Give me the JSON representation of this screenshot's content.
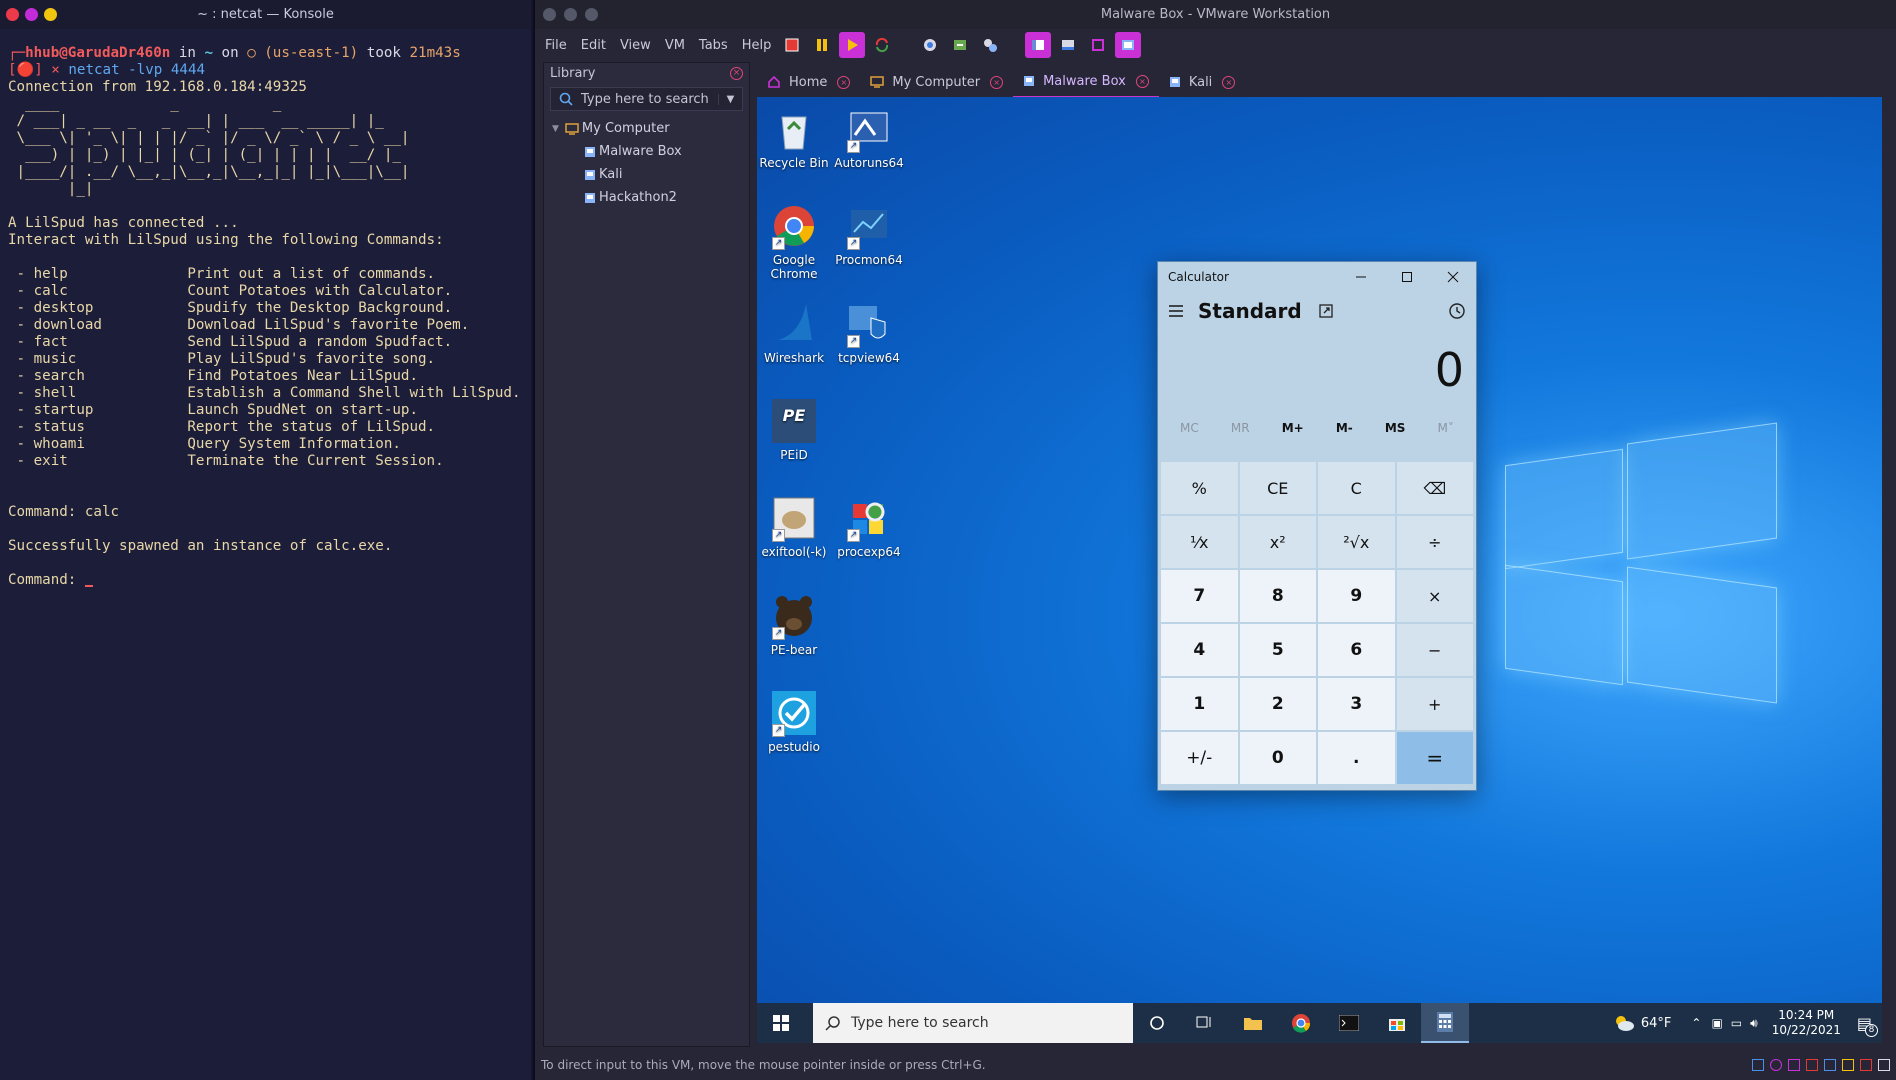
{
  "konsole": {
    "title": "~ : netcat — Konsole",
    "prompt_user": "┌─hhub@GarudaDr460n",
    "prompt_in": " in ",
    "prompt_dir": "~",
    "prompt_on": " on ",
    "prompt_aws": "○ (us-east-1)",
    "prompt_took": " took ",
    "prompt_time": "21m43s",
    "line2_status": "[🔴] ×",
    "line2_cmd": " netcat -lvp 4444",
    "connection": "Connection from 192.168.0.184:49325",
    "banner": "  ____             _           _\n / ___| _ __  _   _  __| | ___  __ _____| |_\n \\___ \\| '_ \\| | | |/ _` |/ _ \\/ _` \\ / _ \\ __|\n  ___) | |_) | |_| | (_| | (_| | | | |  __/ |_\n |____/| .__/ \\__,_|\\__,_|\\__,_|_| |_|\\___|\\__|\n       |_|",
    "intro1": "A LilSpud has connected ...",
    "intro2": "Interact with LilSpud using the following Commands:",
    "commands": [
      {
        "cmd": " - help",
        "desc": "Print out a list of commands."
      },
      {
        "cmd": " - calc",
        "desc": "Count Potatoes with Calculator."
      },
      {
        "cmd": " - desktop",
        "desc": "Spudify the Desktop Background."
      },
      {
        "cmd": " - download",
        "desc": "Download LilSpud's favorite Poem."
      },
      {
        "cmd": " - fact",
        "desc": "Send LilSpud a random Spudfact."
      },
      {
        "cmd": " - music",
        "desc": "Play LilSpud's favorite song."
      },
      {
        "cmd": " - search",
        "desc": "Find Potatoes Near LilSpud."
      },
      {
        "cmd": " - shell",
        "desc": "Establish a Command Shell with LilSpud."
      },
      {
        "cmd": " - startup",
        "desc": "Launch SpudNet on start-up."
      },
      {
        "cmd": " - status",
        "desc": "Report the status of LilSpud."
      },
      {
        "cmd": " - whoami",
        "desc": "Query System Information."
      },
      {
        "cmd": " - exit",
        "desc": "Terminate the Current Session."
      }
    ],
    "cmd_entered": "Command: calc",
    "result": "Successfully spawned an instance of calc.exe.",
    "prompt_next": "Command: "
  },
  "vmware": {
    "title": "Malware Box - VMware Workstation",
    "menus": [
      "File",
      "Edit",
      "View",
      "VM",
      "Tabs",
      "Help"
    ],
    "library": {
      "header": "Library",
      "search_placeholder": "Type here to search",
      "root": "My Computer",
      "vms": [
        "Malware Box",
        "Kali",
        "Hackathon2"
      ]
    },
    "tabs": [
      {
        "label": "Home",
        "active": false
      },
      {
        "label": "My Computer",
        "active": false
      },
      {
        "label": "Malware Box",
        "active": true
      },
      {
        "label": "Kali",
        "active": false
      }
    ],
    "status_text": "To direct input to this VM, move the mouse pointer inside or press Ctrl+G."
  },
  "desktop": {
    "icons": [
      {
        "label": "Recycle Bin",
        "icon": "recycle-bin-icon"
      },
      {
        "label": "Autoruns64",
        "icon": "autoruns-icon"
      },
      {
        "label": "Google Chrome",
        "icon": "chrome-icon"
      },
      {
        "label": "Procmon64",
        "icon": "procmon-icon"
      },
      {
        "label": "Wireshark",
        "icon": "wireshark-icon"
      },
      {
        "label": "tcpview64",
        "icon": "tcpview-icon"
      },
      {
        "label": "PEiD",
        "icon": "peid-icon"
      },
      {
        "label": "exiftool(-k)",
        "icon": "exiftool-icon"
      },
      {
        "label": "procexp64",
        "icon": "procexp-icon"
      },
      {
        "label": "PE-bear",
        "icon": "pe-bear-icon"
      },
      {
        "label": "pestudio",
        "icon": "pestudio-icon"
      }
    ]
  },
  "calculator": {
    "title": "Calculator",
    "mode": "Standard",
    "display": "0",
    "memory": [
      "MC",
      "MR",
      "M+",
      "M-",
      "MS",
      "M˅"
    ],
    "keys": [
      "%",
      "CE",
      "C",
      "⌫",
      "¹⁄x",
      "x²",
      "²√x",
      "÷",
      "7",
      "8",
      "9",
      "×",
      "4",
      "5",
      "6",
      "−",
      "1",
      "2",
      "3",
      "+",
      "+/-",
      "0",
      ".",
      "="
    ]
  },
  "taskbar": {
    "search_placeholder": "Type here to search",
    "weather": "64°F",
    "time": "10:24 PM",
    "date": "10/22/2021",
    "notifications": "8"
  }
}
